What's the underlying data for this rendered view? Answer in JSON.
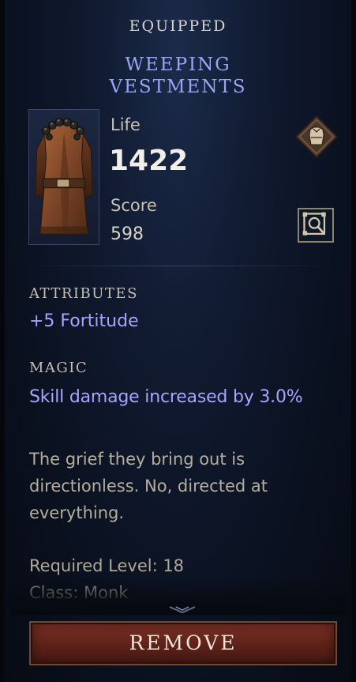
{
  "header": {
    "title": "EQUIPPED"
  },
  "item": {
    "name_line1": "WEEPING",
    "name_line2": "VESTMENTS",
    "portrait_icon": "robe-armor-icon"
  },
  "stats": {
    "life_label": "Life",
    "life_value": "1422",
    "score_label": "Score",
    "score_value": "598"
  },
  "icons": {
    "slot": "chest-armor-slot-icon",
    "compare": "inspect-compare-icon"
  },
  "attributes": {
    "title": "ATTRIBUTES",
    "lines": [
      "+5 Fortitude"
    ]
  },
  "magic": {
    "title": "MAGIC",
    "lines": [
      "Skill damage increased by 3.0%"
    ]
  },
  "flavor": {
    "text": "The grief they bring out is directionless. No, directed at everything."
  },
  "requirements": {
    "level": "Required Level: 18",
    "class": "Class: Monk"
  },
  "actions": {
    "remove_label": "REMOVE"
  },
  "colors": {
    "title_blue": "#9aa6f5",
    "affix_purple": "#a8a3ff",
    "button_red": "#6d2a20"
  }
}
